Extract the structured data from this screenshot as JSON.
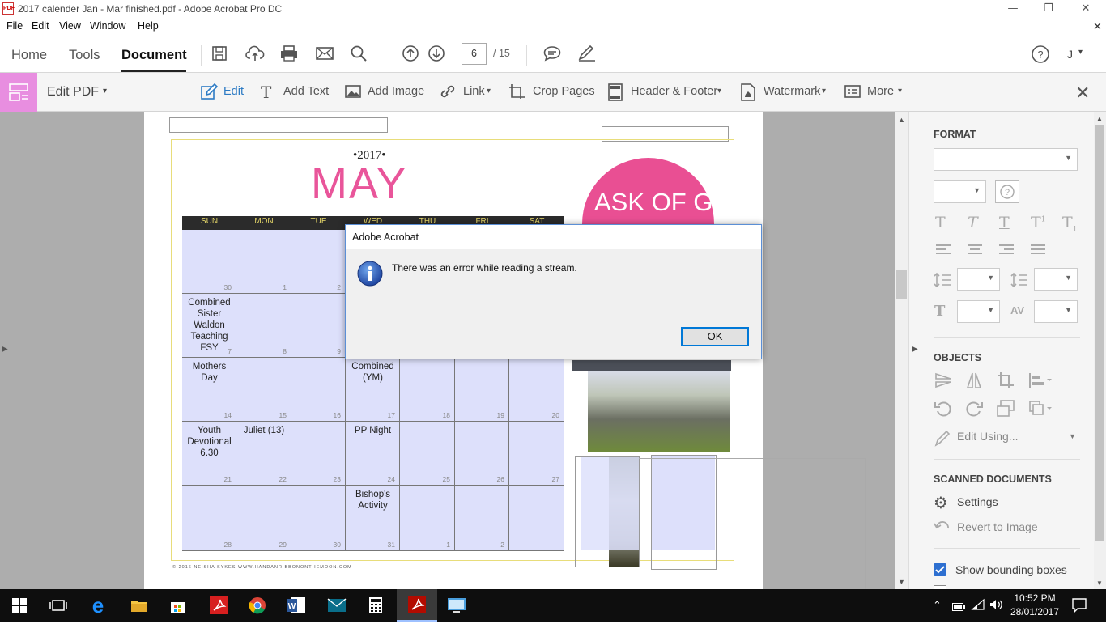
{
  "window": {
    "title": "2017 calender Jan - Mar finished.pdf - Adobe Acrobat Pro DC",
    "minimize": "—",
    "restore": "❐",
    "close": "✕"
  },
  "menu": [
    "File",
    "Edit",
    "View",
    "Window",
    "Help"
  ],
  "tabs": {
    "home": "Home",
    "tools": "Tools",
    "document": "Document"
  },
  "page_nav": {
    "current": "6",
    "total": "/ 15"
  },
  "account": "J",
  "edit_toolbar": {
    "title": "Edit PDF",
    "edit": "Edit",
    "add_text": "Add Text",
    "add_image": "Add Image",
    "link": "Link",
    "crop": "Crop Pages",
    "header_footer": "Header & Footer",
    "watermark": "Watermark",
    "more": "More"
  },
  "calendar": {
    "year": "•2017•",
    "month": "MAY",
    "badge": "ASK OF GOD",
    "days": [
      "SUN",
      "MON",
      "TUE",
      "WED",
      "THU",
      "FRI",
      "SAT"
    ],
    "footer": "© 2016 NEISHA SYKES WWW.HANDANRIBBONONTHEMOON.COM",
    "events": {
      "w2_sun": "Combined Sister Waldon Teaching FSY",
      "w3_sun": "Mothers Day",
      "w3_wed": "Combined (YM)",
      "w4_sun": "Youth Devotional 6.30",
      "w4_mon": "Juliet (13)",
      "w4_wed": "PP Night",
      "w5_wed": "Bishop's Activity"
    },
    "nums": {
      "r1": [
        "30",
        "1",
        "2",
        "",
        "",
        "",
        ""
      ],
      "r2": [
        "7",
        "8",
        "9",
        "",
        "",
        "",
        ""
      ],
      "r3": [
        "14",
        "15",
        "16",
        "17",
        "18",
        "19",
        "20"
      ],
      "r4": [
        "21",
        "22",
        "23",
        "24",
        "25",
        "26",
        "27"
      ],
      "r5": [
        "28",
        "29",
        "30",
        "31",
        "1",
        "2",
        ""
      ]
    }
  },
  "dialog": {
    "title": "Adobe Acrobat",
    "message": "There was an error while reading a stream.",
    "ok": "OK"
  },
  "right_panel": {
    "format": "FORMAT",
    "objects": "OBJECTS",
    "edit_using": "Edit Using...",
    "scanned": "SCANNED DOCUMENTS",
    "settings": "Settings",
    "revert": "Revert to Image",
    "show_bbox": "Show bounding boxes"
  },
  "clock": {
    "time": "10:52 PM",
    "date": "28/01/2017"
  },
  "colors": {
    "accent": "#e9559a",
    "edit_icon_bg": "#e88ee0",
    "cell_bg": "#dde0fb",
    "header_band": "#2b2b2b"
  }
}
